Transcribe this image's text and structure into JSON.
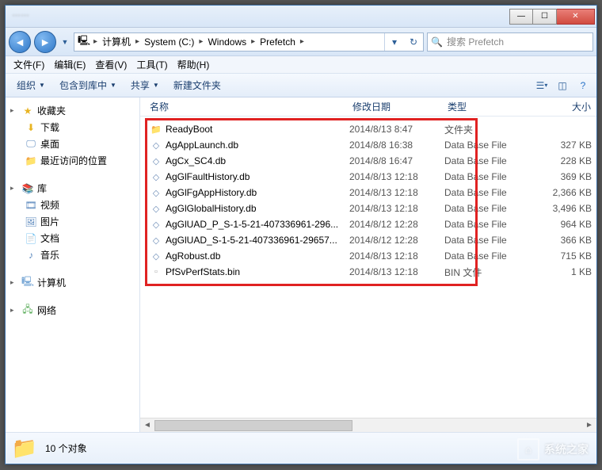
{
  "titlebar": {
    "text": "……"
  },
  "breadcrumb": {
    "computer": "计算机",
    "drive": "System (C:)",
    "folder1": "Windows",
    "folder2": "Prefetch"
  },
  "search": {
    "placeholder": "搜索 Prefetch"
  },
  "menubar": {
    "file": "文件(F)",
    "edit": "编辑(E)",
    "view": "查看(V)",
    "tools": "工具(T)",
    "help": "帮助(H)"
  },
  "toolbar": {
    "organize": "组织",
    "include": "包含到库中",
    "share": "共享",
    "newfolder": "新建文件夹"
  },
  "nav": {
    "favorites": "收藏夹",
    "downloads": "下载",
    "desktop": "桌面",
    "recent": "最近访问的位置",
    "library": "库",
    "videos": "视频",
    "pictures": "图片",
    "documents": "文档",
    "music": "音乐",
    "computer": "计算机",
    "network": "网络"
  },
  "columns": {
    "name": "名称",
    "date": "修改日期",
    "type": "类型",
    "size": "大小"
  },
  "files": [
    {
      "icon": "folder",
      "name": "ReadyBoot",
      "date": "2014/8/13 8:47",
      "type": "文件夹",
      "size": ""
    },
    {
      "icon": "db",
      "name": "AgAppLaunch.db",
      "date": "2014/8/8 16:38",
      "type": "Data Base File",
      "size": "327 KB"
    },
    {
      "icon": "db",
      "name": "AgCx_SC4.db",
      "date": "2014/8/8 16:47",
      "type": "Data Base File",
      "size": "228 KB"
    },
    {
      "icon": "db",
      "name": "AgGlFaultHistory.db",
      "date": "2014/8/13 12:18",
      "type": "Data Base File",
      "size": "369 KB"
    },
    {
      "icon": "db",
      "name": "AgGlFgAppHistory.db",
      "date": "2014/8/13 12:18",
      "type": "Data Base File",
      "size": "2,366 KB"
    },
    {
      "icon": "db",
      "name": "AgGlGlobalHistory.db",
      "date": "2014/8/13 12:18",
      "type": "Data Base File",
      "size": "3,496 KB"
    },
    {
      "icon": "db",
      "name": "AgGlUAD_P_S-1-5-21-407336961-296...",
      "date": "2014/8/12 12:28",
      "type": "Data Base File",
      "size": "964 KB"
    },
    {
      "icon": "db",
      "name": "AgGlUAD_S-1-5-21-407336961-29657...",
      "date": "2014/8/12 12:28",
      "type": "Data Base File",
      "size": "366 KB"
    },
    {
      "icon": "db",
      "name": "AgRobust.db",
      "date": "2014/8/13 12:18",
      "type": "Data Base File",
      "size": "715 KB"
    },
    {
      "icon": "bin",
      "name": "PfSvPerfStats.bin",
      "date": "2014/8/13 12:18",
      "type": "BIN 文件",
      "size": "1 KB"
    }
  ],
  "status": {
    "count": "10 个对象"
  },
  "watermark": {
    "text": "系统之家"
  }
}
